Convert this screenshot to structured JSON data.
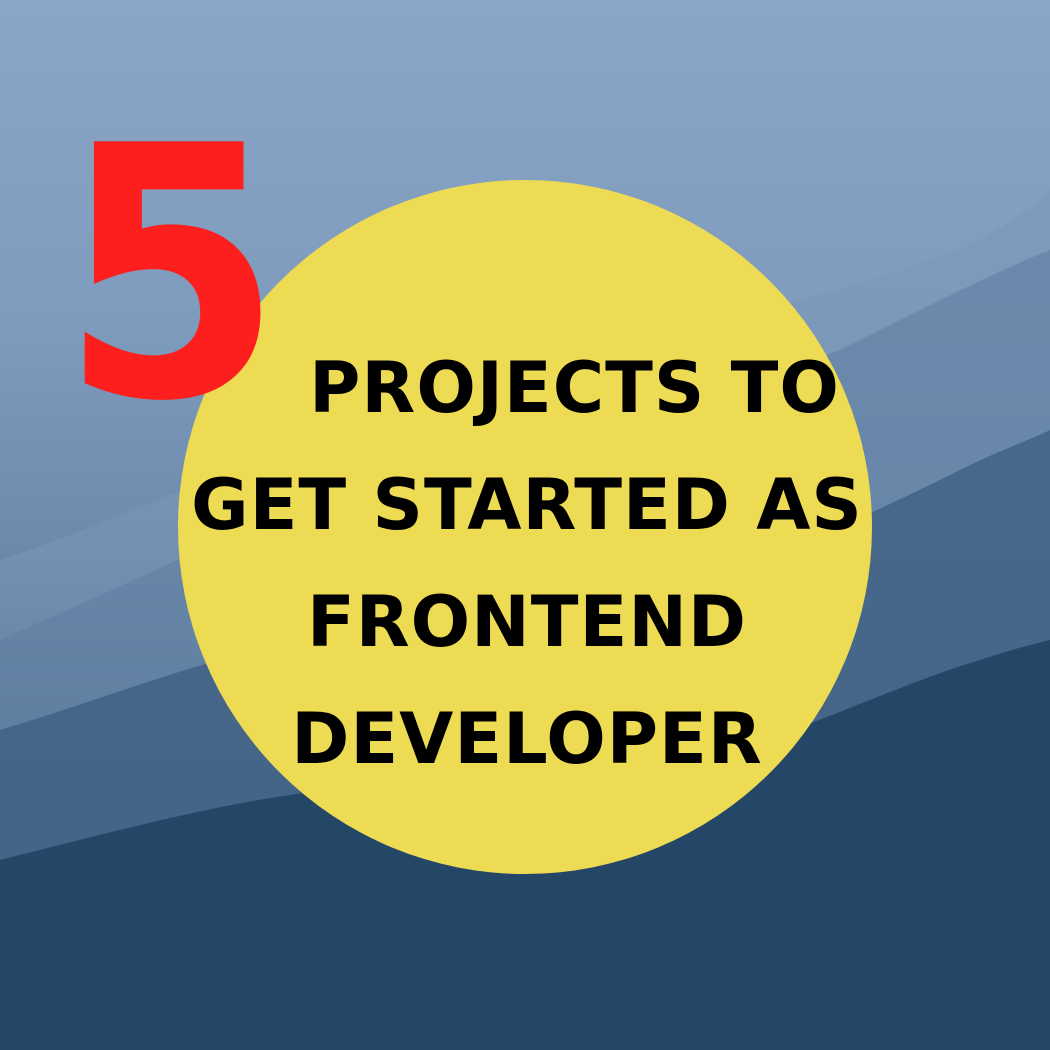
{
  "poster": {
    "number": "5",
    "headline_lines": [
      "PROJECTS TO",
      "GET STARTED AS",
      "FRONTEND",
      "DEVELOPER"
    ]
  },
  "colors": {
    "number": "#fd1e1e",
    "circle": "#eddb54",
    "headline_text": "#000000",
    "sky_top": "#8aa6c6",
    "mountains_dark": "#183552"
  }
}
